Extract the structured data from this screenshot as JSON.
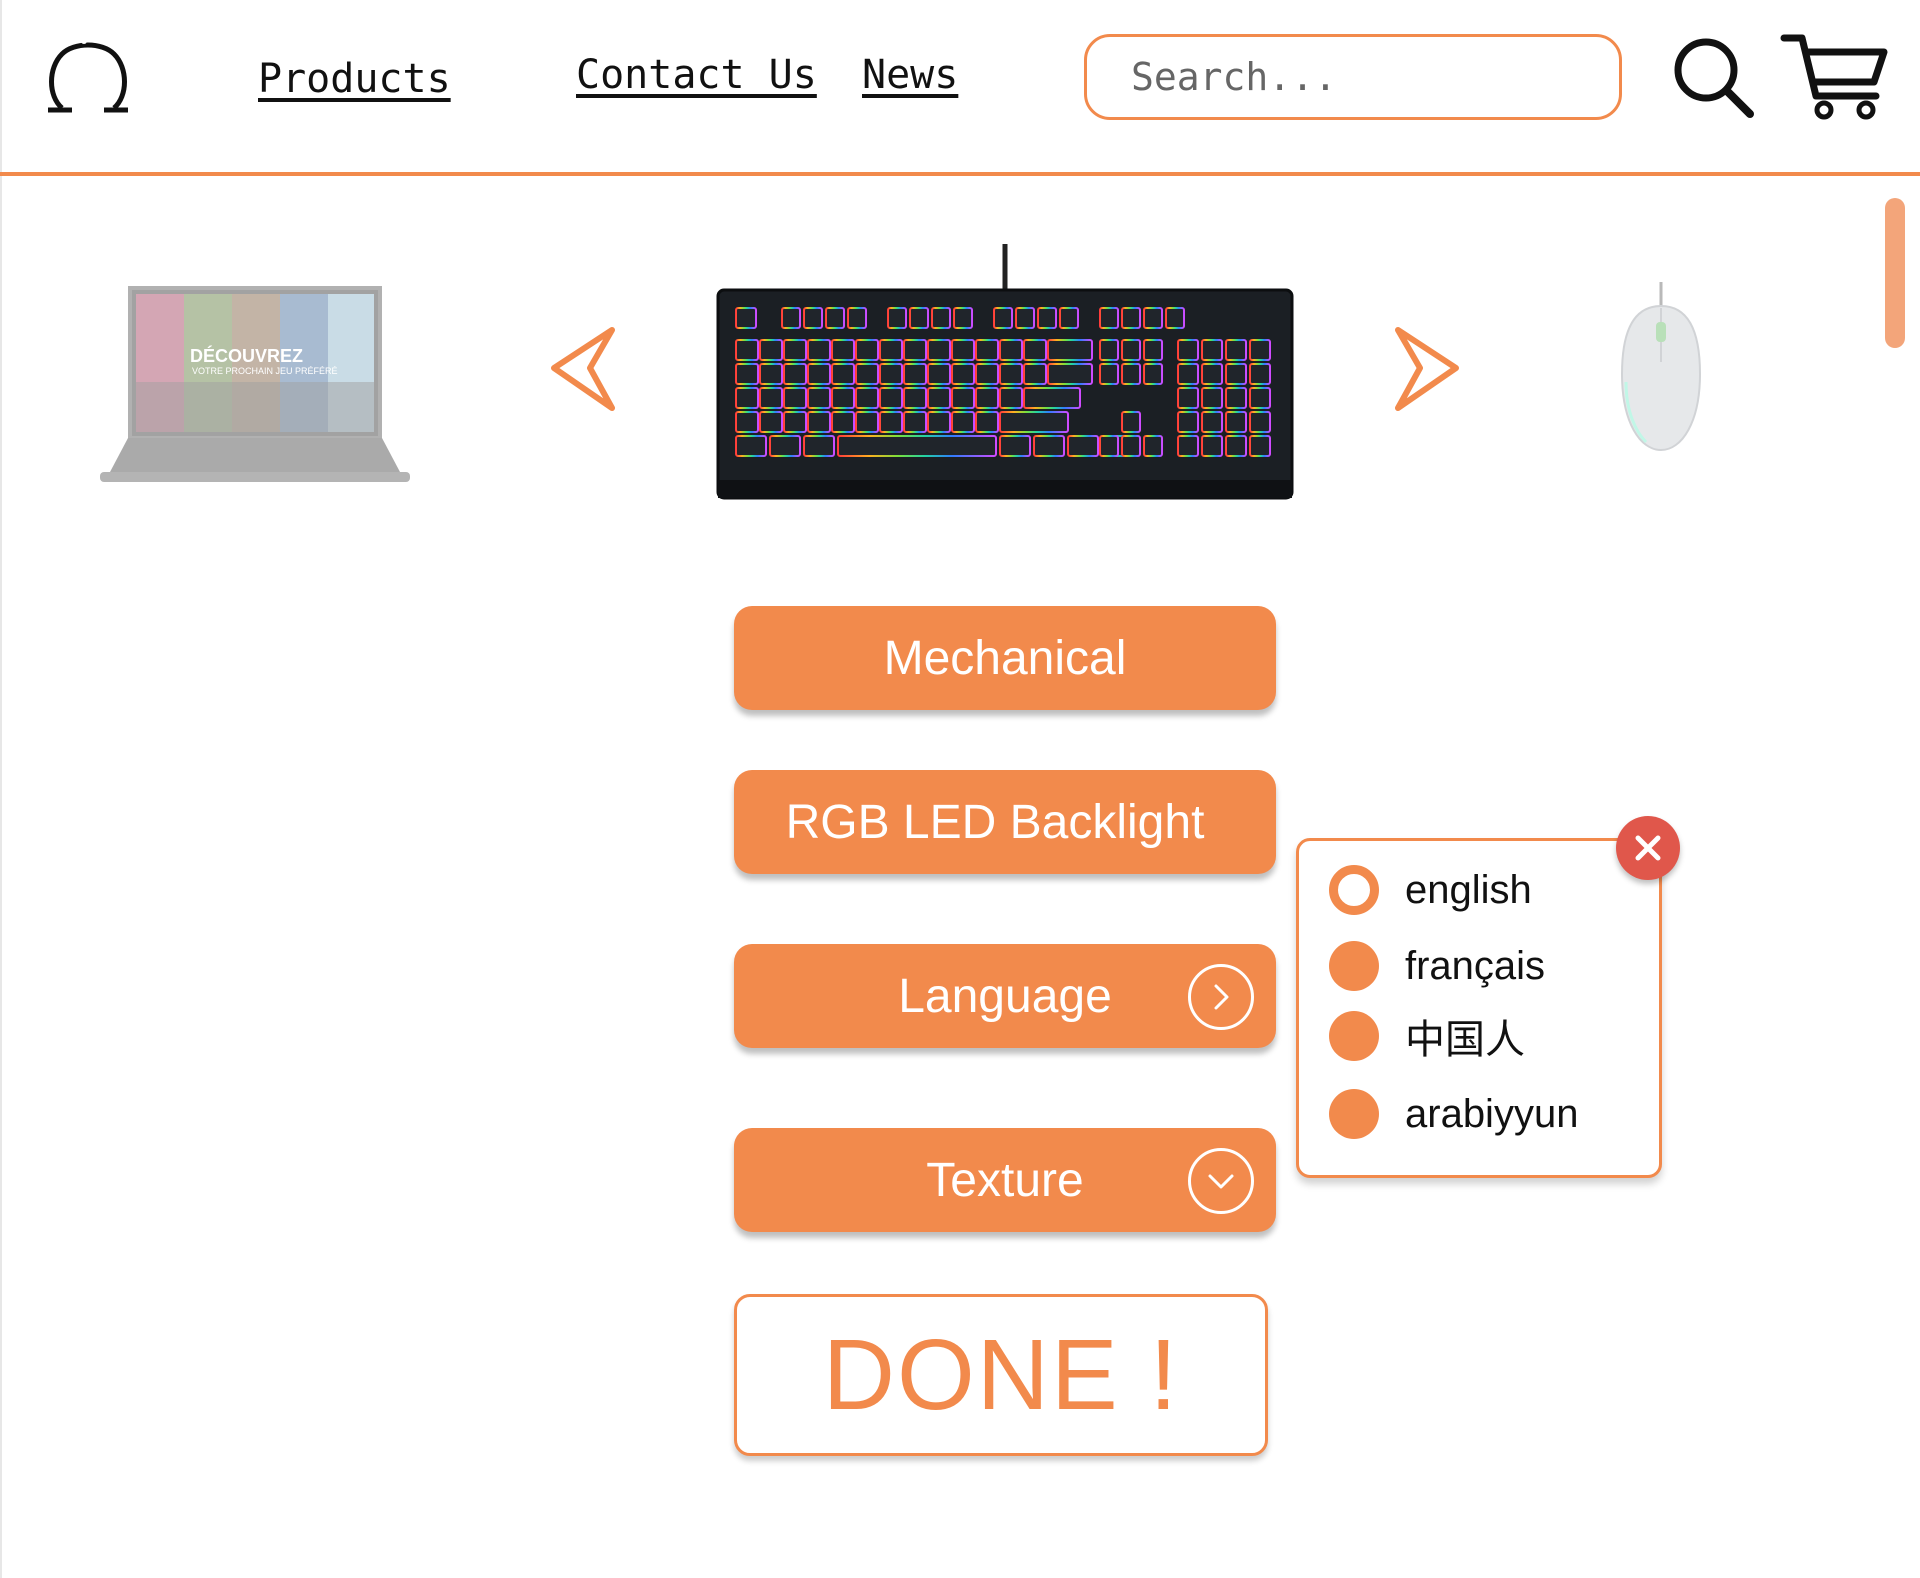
{
  "nav": {
    "products": "Products",
    "contact": "Contact Us",
    "news": "News"
  },
  "search": {
    "placeholder": "Search..."
  },
  "icons": {
    "logo": "omega-logo-icon",
    "search": "search-icon",
    "cart": "cart-icon",
    "prev": "chevron-left-icon",
    "next": "chevron-right-icon",
    "language_chevron": "chevron-right-circle-icon",
    "texture_chevron": "chevron-down-circle-icon",
    "close": "close-icon"
  },
  "carousel": {
    "left_laptop_text": "DÉCOUVREZ",
    "left_laptop_subtext": "VOTRE PROCHAIN JEU PRÉFÉRÉ"
  },
  "options": {
    "mechanical": "Mechanical",
    "rgb": "RGB LED Backlight",
    "language": "Language",
    "texture": "Texture"
  },
  "done": "DONE !",
  "language_popup": {
    "items": [
      {
        "label": "english",
        "selected": true
      },
      {
        "label": "français",
        "selected": false
      },
      {
        "label": "中国人",
        "selected": false
      },
      {
        "label": "arabiyyun",
        "selected": false
      }
    ]
  },
  "colors": {
    "accent": "#f28a4c",
    "close": "#e0574b"
  }
}
